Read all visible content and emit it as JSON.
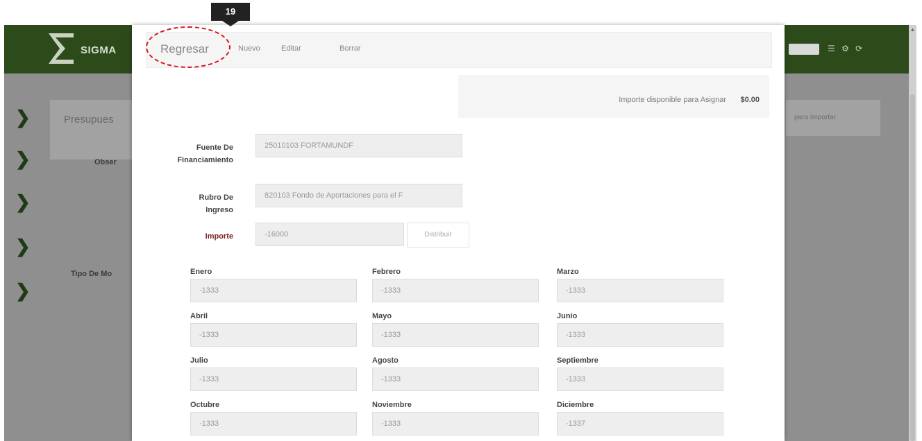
{
  "step_badge": "19",
  "background": {
    "brand": "SIGMA",
    "panel_text": "Presupues",
    "observ_label": "Obser",
    "tipo_label": "Tipo De Mo",
    "right_panel_text": "para Importar",
    "header_icons": "☰ ⚙ ⟳"
  },
  "toolbar": {
    "back_label": "Regresar",
    "new_label": "Nuevo",
    "edit_label": "Editar",
    "delete_label": "Borrar"
  },
  "available": {
    "label": "Importe disponible para Asignar",
    "value": "$0.00"
  },
  "form": {
    "fuente_label": "Fuente De Financiamiento",
    "fuente_value": "25010103 FORTAMUNDF",
    "rubro_label": "Rubro De Ingreso",
    "rubro_value": "820103 Fondo de Aportaciones para el F",
    "importe_label": "Importe",
    "importe_value": "-16000",
    "distribuir_label": "Distribuir"
  },
  "months": [
    {
      "label": "Enero",
      "value": "-1333"
    },
    {
      "label": "Febrero",
      "value": "-1333"
    },
    {
      "label": "Marzo",
      "value": "-1333"
    },
    {
      "label": "Abril",
      "value": "-1333"
    },
    {
      "label": "Mayo",
      "value": "-1333"
    },
    {
      "label": "Junio",
      "value": "-1333"
    },
    {
      "label": "Julio",
      "value": "-1333"
    },
    {
      "label": "Agosto",
      "value": "-1333"
    },
    {
      "label": "Septiembre",
      "value": "-1333"
    },
    {
      "label": "Octubre",
      "value": "-1333"
    },
    {
      "label": "Noviembre",
      "value": "-1333"
    },
    {
      "label": "Diciembre",
      "value": "-1337"
    }
  ],
  "colors": {
    "header": "#2d4a1b",
    "highlight": "#d9121b",
    "overlay": "#8f8f8f"
  }
}
